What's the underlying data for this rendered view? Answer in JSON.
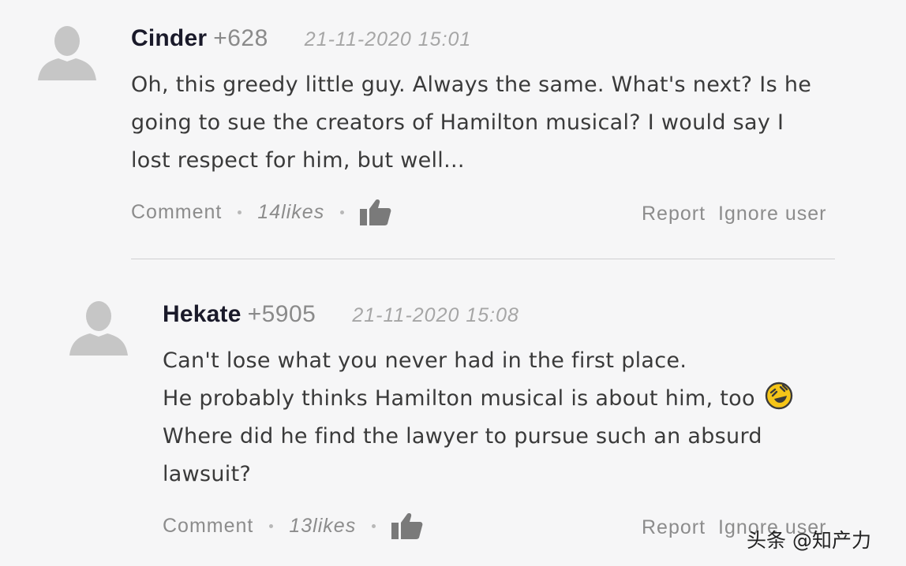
{
  "comments": [
    {
      "username": "Cinder",
      "karma": "+628",
      "timestamp": "21-11-2020 15:01",
      "lines": [
        "Oh, this greedy little guy. Always the same. What's next? Is he",
        "going to sue the creators of Hamilton musical? I would say I",
        "lost respect for him, but well..."
      ],
      "comment_label": "Comment",
      "likes": "14likes",
      "report_label": "Report",
      "ignore_label": "Ignore user",
      "avatar_icon": "user-avatar-placeholder-icon",
      "like_icon": "thumbs-up-icon"
    },
    {
      "username": "Hekate",
      "karma": "+5905",
      "timestamp": "21-11-2020 15:08",
      "lines": [
        "Can't lose what you never had in the first place.",
        "He probably thinks Hamilton musical is about him, too",
        "Where did he find the lawyer to pursue such an absurd",
        "lawsuit?"
      ],
      "emoji_icon": "rolling-on-floor-laughing-emoji-icon",
      "comment_label": "Comment",
      "likes": "13likes",
      "report_label": "Report",
      "ignore_label": "Ignore user",
      "avatar_icon": "user-avatar-placeholder-icon",
      "like_icon": "thumbs-up-icon"
    }
  ],
  "watermark": "头条 @知产力",
  "colors": {
    "background": "#f6f6f7",
    "username": "#1a1a2a",
    "muted": "#8c8c8c",
    "avatar": "#c6c6c6",
    "emoji": "#f5c518"
  }
}
